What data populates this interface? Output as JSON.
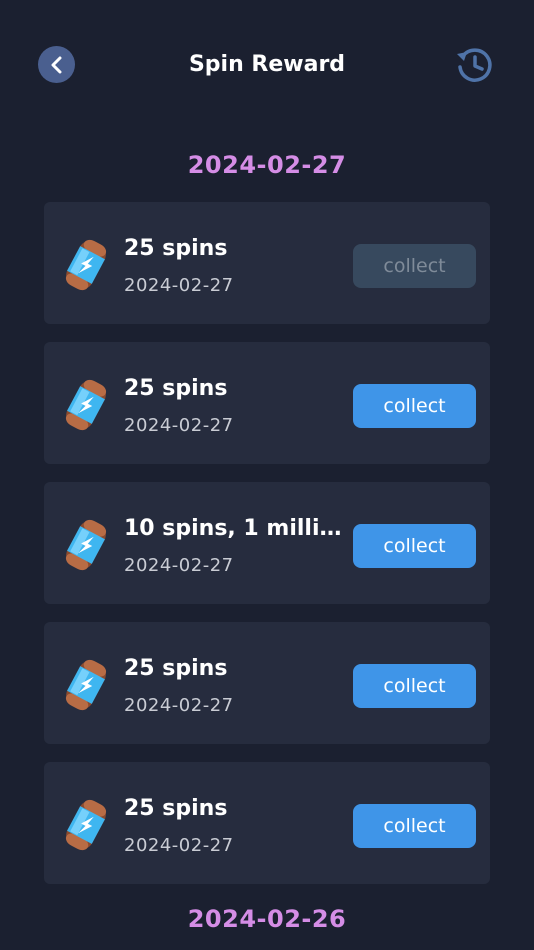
{
  "header": {
    "title": "Spin Reward",
    "back_icon": "back-arrow-icon",
    "history_icon": "history-icon"
  },
  "sections": [
    {
      "date": "2024-02-27",
      "items": [
        {
          "title": "25 spins",
          "date": "2024-02-27",
          "button": "collect",
          "state": "disabled"
        },
        {
          "title": "25 spins",
          "date": "2024-02-27",
          "button": "collect",
          "state": "enabled"
        },
        {
          "title": "10 spins, 1 millio...",
          "date": "2024-02-27",
          "button": "collect",
          "state": "enabled"
        },
        {
          "title": "25 spins",
          "date": "2024-02-27",
          "button": "collect",
          "state": "enabled"
        },
        {
          "title": "25 spins",
          "date": "2024-02-27",
          "button": "collect",
          "state": "enabled"
        }
      ]
    },
    {
      "date": "2024-02-26",
      "items": []
    }
  ],
  "colors": {
    "background": "#1b2030",
    "card": "#262c3e",
    "accent_date": "#d58de6",
    "button": "#3f95e8",
    "button_disabled": "#37495e"
  },
  "item_icon": "energy-capsule-icon"
}
